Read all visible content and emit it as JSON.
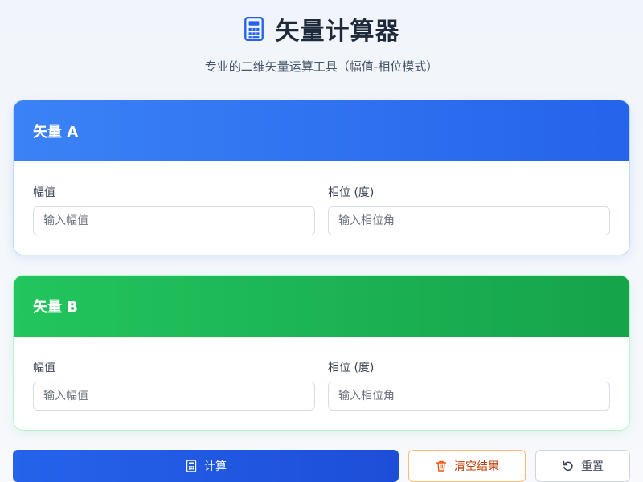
{
  "header": {
    "title": "矢量计算器",
    "subtitle": "专业的二维矢量运算工具（幅值-相位模式）",
    "icon": "calculator-icon"
  },
  "vector_a": {
    "title": "矢量 A",
    "color": "#3b82f6",
    "magnitude": {
      "label": "幅值",
      "value": "",
      "placeholder": "输入幅值"
    },
    "phase": {
      "label": "相位 (度)",
      "value": "",
      "placeholder": "输入相位角"
    }
  },
  "vector_b": {
    "title": "矢量 B",
    "color": "#22c55e",
    "magnitude": {
      "label": "幅值",
      "value": "",
      "placeholder": "输入幅值"
    },
    "phase": {
      "label": "相位 (度)",
      "value": "",
      "placeholder": "输入相位角"
    }
  },
  "actions": {
    "calculate": {
      "label": "计算",
      "icon": "calculator-icon"
    },
    "clear": {
      "label": "清空结果",
      "icon": "trash-icon"
    },
    "reset": {
      "label": "重置",
      "icon": "rotate-ccw-icon"
    }
  }
}
